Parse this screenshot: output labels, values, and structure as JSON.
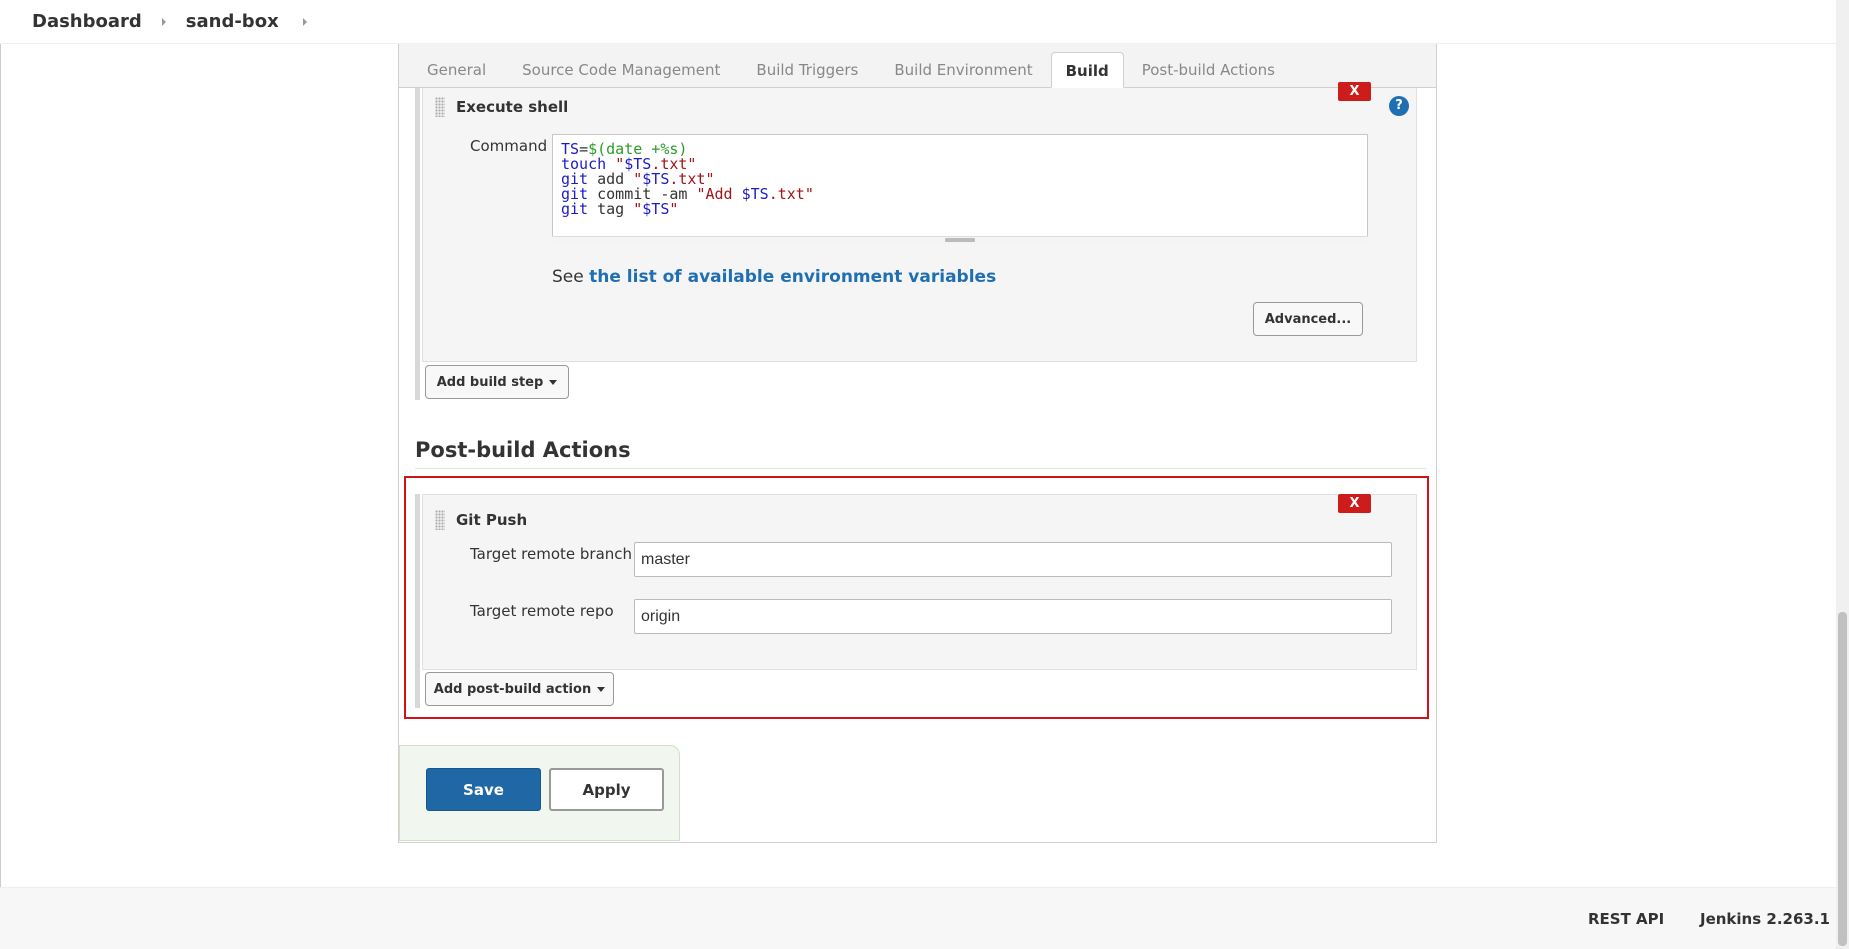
{
  "breadcrumb": {
    "items": [
      {
        "label": "Dashboard"
      },
      {
        "label": "sand-box"
      }
    ]
  },
  "tabs": [
    {
      "label": "General",
      "active": false
    },
    {
      "label": "Source Code Management",
      "active": false
    },
    {
      "label": "Build Triggers",
      "active": false
    },
    {
      "label": "Build Environment",
      "active": false
    },
    {
      "label": "Build",
      "active": true
    },
    {
      "label": "Post-build Actions",
      "active": false
    }
  ],
  "build": {
    "step_title": "Execute shell",
    "delete_label": "X",
    "help_label": "?",
    "command_label": "Command",
    "command_lines": [
      "TS=$(date +%s)",
      "touch \"$TS.txt\"",
      "git add \"$TS.txt\"",
      "git commit -am \"Add $TS.txt\"",
      "git tag \"$TS\""
    ],
    "env_note_prefix": "See ",
    "env_link": "the list of available environment variables",
    "advanced_label": "Advanced...",
    "add_step_label": "Add build step"
  },
  "post_build": {
    "heading": "Post-build Actions",
    "step_title": "Git Push",
    "delete_label": "X",
    "branch_label": "Target remote branch",
    "branch_value": "master",
    "repo_label": "Target remote repo",
    "repo_value": "origin",
    "add_action_label": "Add post-build action"
  },
  "actions": {
    "save_label": "Save",
    "apply_label": "Apply"
  },
  "footer": {
    "rest_api": "REST API",
    "version": "Jenkins 2.263.1"
  },
  "colors": {
    "primary": "#1f67a5",
    "danger": "#cc1c1c",
    "highlight_border": "#d0121b",
    "link": "#1f6fb2"
  }
}
